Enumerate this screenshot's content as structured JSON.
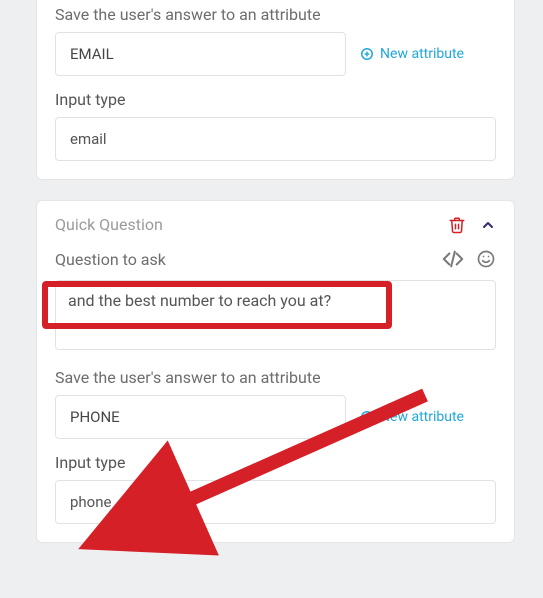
{
  "card1": {
    "save_attr_label": "Save the user's answer to an attribute",
    "attribute_value": "EMAIL",
    "new_attribute_label": "New attribute",
    "input_type_label": "Input type",
    "input_type_value": "email"
  },
  "card2": {
    "title": "Quick Question",
    "question_label": "Question to ask",
    "question_value": "and the best number to reach you at?",
    "save_attr_label": "Save the user's answer to an attribute",
    "attribute_value": "PHONE",
    "new_attribute_label": "New attribute",
    "input_type_label": "Input type",
    "input_type_value": "phone"
  },
  "icons": {
    "trash": "trash-icon",
    "chevron_up": "chevron-up-icon",
    "code": "code-icon",
    "smile": "smile-icon",
    "plus_circle": "plus-circle-icon"
  }
}
